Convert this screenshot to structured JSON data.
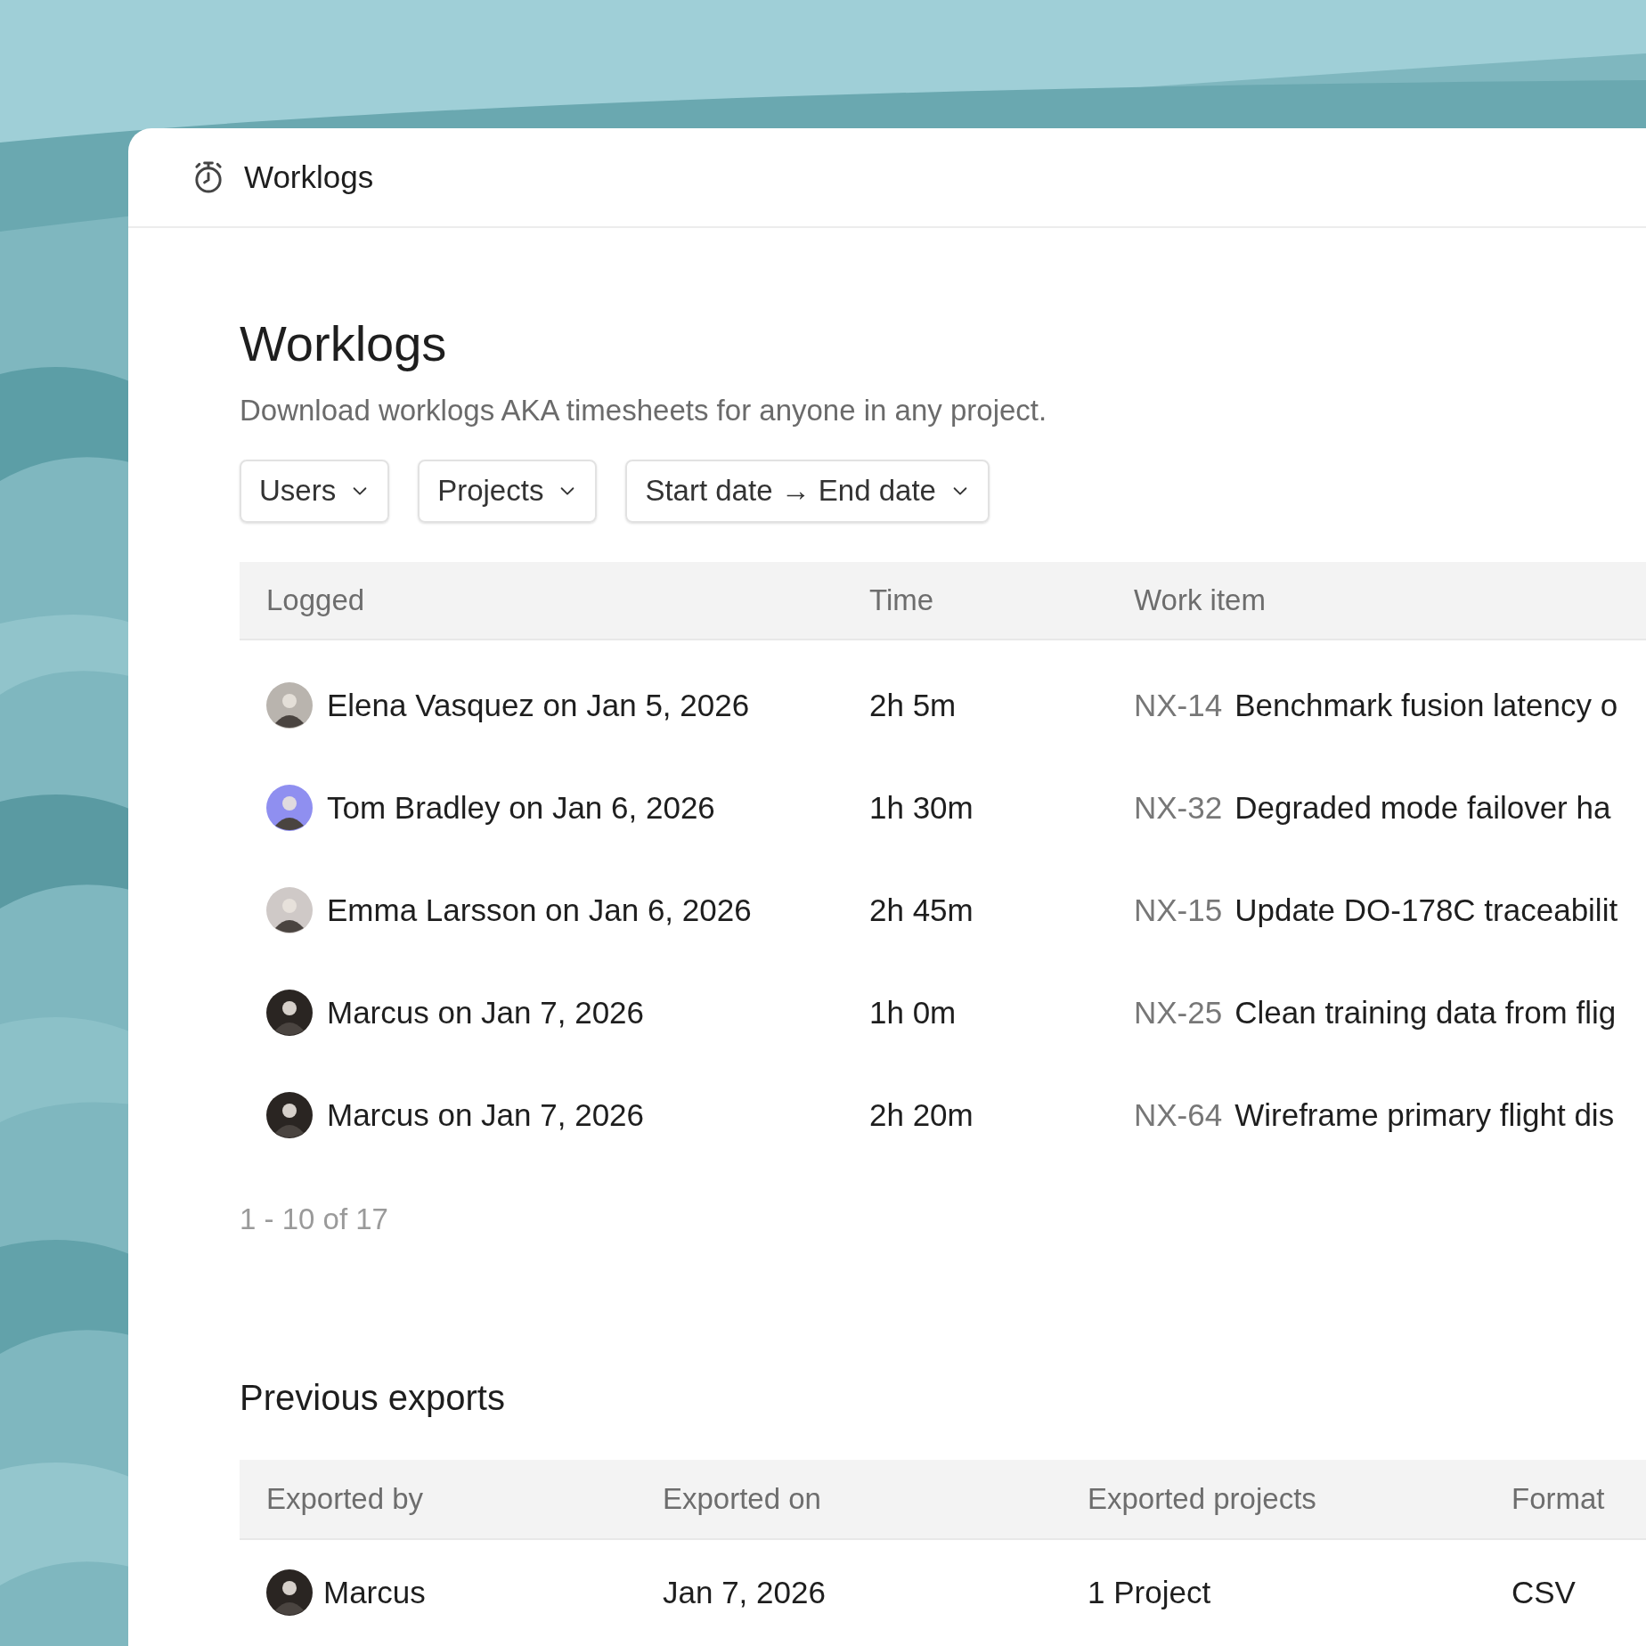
{
  "header": {
    "title": "Worklogs"
  },
  "page": {
    "title": "Worklogs",
    "subtitle": "Download worklogs AKA timesheets for anyone in any project."
  },
  "filters": [
    {
      "label": "Users"
    },
    {
      "label": "Projects"
    },
    {
      "label": "Start date → End date"
    }
  ],
  "worklogs": {
    "columns": [
      "Logged",
      "Time",
      "Work item"
    ],
    "rows": [
      {
        "logged": "Elena Vasquez on Jan 5, 2026",
        "color": "#b9b4ae",
        "time": "2h 5m",
        "key": "NX-14",
        "item": "Benchmark fusion latency o"
      },
      {
        "logged": "Tom Bradley on Jan 6, 2026",
        "color": "#8f8ff0",
        "time": "1h 30m",
        "key": "NX-32",
        "item": "Degraded mode failover ha"
      },
      {
        "logged": "Emma Larsson on Jan 6, 2026",
        "color": "#cfc9c7",
        "time": "2h 45m",
        "key": "NX-15",
        "item": "Update DO-178C traceabilit"
      },
      {
        "logged": "Marcus on Jan 7, 2026",
        "color": "#2a2522",
        "time": "1h 0m",
        "key": "NX-25",
        "item": "Clean training data from flig"
      },
      {
        "logged": "Marcus on Jan 7, 2026",
        "color": "#2a2522",
        "time": "2h 20m",
        "key": "NX-64",
        "item": "Wireframe primary flight dis"
      }
    ]
  },
  "pagination": "1 - 10 of 17",
  "exports": {
    "title": "Previous exports",
    "columns": [
      "Exported by",
      "Exported on",
      "Exported projects",
      "Format"
    ],
    "rows": [
      {
        "by": "Marcus",
        "color": "#2a2522",
        "on": "Jan 7, 2026",
        "projects": "1 Project",
        "format": "CSV"
      }
    ]
  }
}
